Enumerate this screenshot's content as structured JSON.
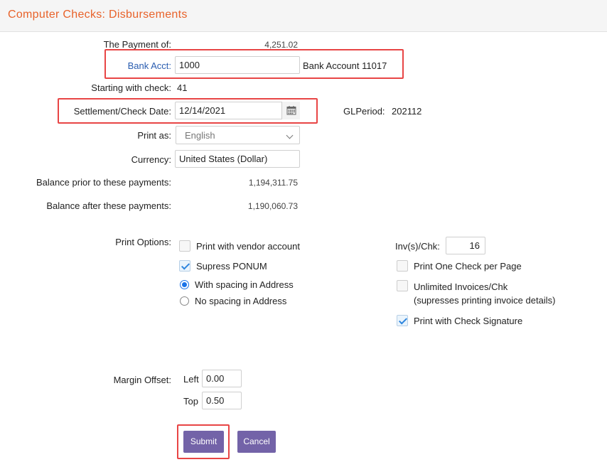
{
  "header": {
    "title": "Computer Checks: Disbursements"
  },
  "form": {
    "payment_label": "The Payment of:",
    "payment_value": "4,251.02",
    "bank_acct_label": "Bank Acct:",
    "bank_acct_value": "1000",
    "bank_acct_name": "Bank Account 11017",
    "starting_check_label": "Starting with check:",
    "starting_check_value": "41",
    "date_label": "Settlement/Check Date:",
    "date_value": "12/14/2021",
    "glperiod_label": "GLPeriod:",
    "glperiod_value": "202112",
    "print_as_label": "Print as:",
    "print_as_value": "English",
    "currency_label": "Currency:",
    "currency_value": "United States (Dollar)",
    "balance_prior_label": "Balance prior to these payments:",
    "balance_prior_value": "1,194,311.75",
    "balance_after_label": "Balance after these payments:",
    "balance_after_value": "1,190,060.73"
  },
  "print_options": {
    "label": "Print Options:",
    "vendor_account": {
      "label": "Print with vendor account",
      "checked": false
    },
    "supress_ponum": {
      "label": "Supress PONUM",
      "checked": true
    },
    "with_spacing": {
      "label": "With spacing in Address",
      "selected": true
    },
    "no_spacing": {
      "label": "No spacing in Address",
      "selected": false
    },
    "inv_per_chk_label": "Inv(s)/Chk:",
    "inv_per_chk_value": "16",
    "one_check_per_page": {
      "label": "Print One Check per Page",
      "checked": false
    },
    "unlimited_invoices": {
      "label": "Unlimited Invoices/Chk",
      "sublabel": "(supresses printing invoice details)",
      "checked": false
    },
    "check_signature": {
      "label": "Print with Check Signature",
      "checked": true
    }
  },
  "margin": {
    "label": "Margin Offset:",
    "left_label": "Left",
    "left_value": "0.00",
    "top_label": "Top",
    "top_value": "0.50"
  },
  "buttons": {
    "submit": "Submit",
    "cancel": "Cancel"
  },
  "colors": {
    "accent": "#e8622a",
    "button": "#7363a8",
    "highlight": "#e84545",
    "link": "#2a5db0",
    "check": "#2e86de"
  }
}
